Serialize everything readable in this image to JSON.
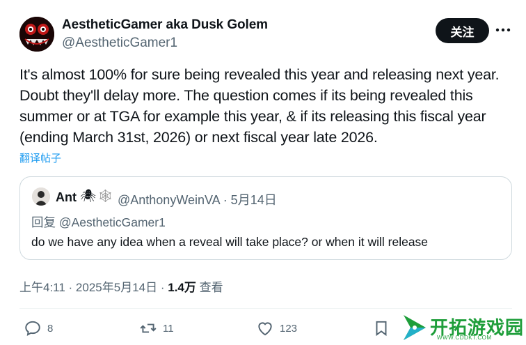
{
  "author": {
    "display_name": "AestheticGamer aka Dusk Golem",
    "handle": "@AestheticGamer1"
  },
  "follow_label": "关注",
  "tweet": {
    "lines": [
      "It's almost 100% for sure being revealed this year and releasing next year.",
      "Doubt they'll delay more. The question comes if its being revealed this",
      "summer or at TGA for example this year, & if its releasing this fiscal year",
      "(ending March 31st, 2026) or next fiscal year late 2026."
    ],
    "translate_label": "翻译帖子"
  },
  "quote": {
    "name": "Ant",
    "emoji_1": "🕷",
    "emoji_2": "🕸",
    "handle_date": "@AnthonyWeinVA · 5月14日",
    "reply_to": "回复 @AestheticGamer1",
    "text": "do we have any idea when a reveal will take place? or when it will release"
  },
  "meta": {
    "time_date": "上午4:11 · 2025年5月14日 · ",
    "views_count": "1.4万",
    "views_label": " 查看"
  },
  "actions": {
    "replies": "8",
    "reposts": "11",
    "likes": "123"
  },
  "watermark": {
    "title": "开拓游戏园",
    "url": "WWW.CDDKT.COM"
  }
}
